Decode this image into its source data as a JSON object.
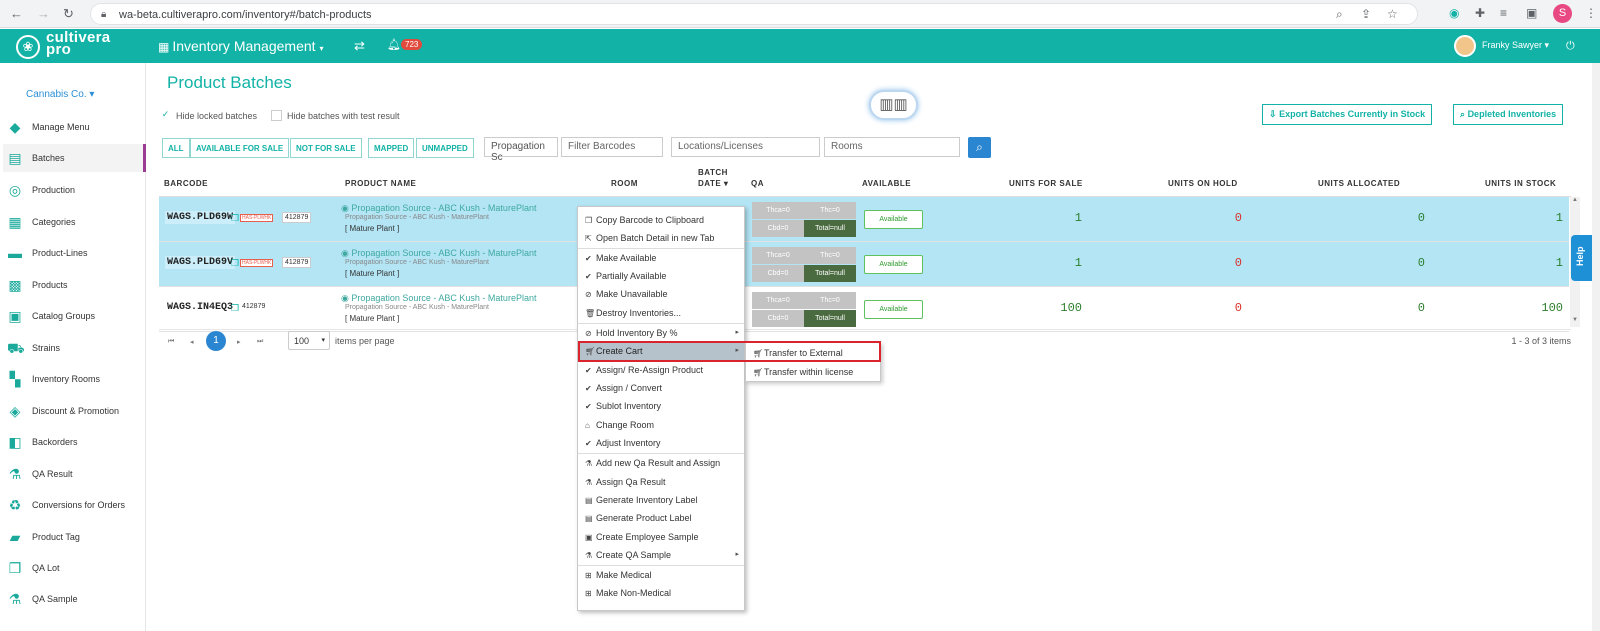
{
  "browser": {
    "url": "wa-beta.cultiverapro.com/inventory#/batch-products",
    "profile_initial": "S"
  },
  "header": {
    "logo_top": "cultivera",
    "logo_bottom": "pro",
    "module": "Inventory Management",
    "notifications": "723",
    "user": "Franky Sawyer"
  },
  "sidebar": {
    "company": "Cannabis Co.",
    "items": [
      {
        "label": "Manage Menu",
        "icon": "tag-icon"
      },
      {
        "label": "Batches",
        "icon": "clipboard-icon"
      },
      {
        "label": "Production",
        "icon": "spiral-icon"
      },
      {
        "label": "Categories",
        "icon": "table-icon"
      },
      {
        "label": "Product-Lines",
        "icon": "product-lines-icon"
      },
      {
        "label": "Products",
        "icon": "grid-icon"
      },
      {
        "label": "Catalog Groups",
        "icon": "catalog-icon"
      },
      {
        "label": "Strains",
        "icon": "truck-icon"
      },
      {
        "label": "Inventory Rooms",
        "icon": "rooms-icon"
      },
      {
        "label": "Discount & Promotion",
        "icon": "tags-icon"
      },
      {
        "label": "Backorders",
        "icon": "backorder-icon"
      },
      {
        "label": "QA Result",
        "icon": "flask-icon"
      },
      {
        "label": "Conversions for Orders",
        "icon": "recycle-icon"
      },
      {
        "label": "Product Tag",
        "icon": "label-icon"
      },
      {
        "label": "QA Lot",
        "icon": "copy-icon"
      },
      {
        "label": "QA Sample",
        "icon": "flask-icon"
      }
    ]
  },
  "page": {
    "title": "Product Batches",
    "hide_locked": "Hide locked batches",
    "hide_test": "Hide batches with test result",
    "export_btn": "Export Batches Currently in Stock",
    "depleted_btn": "Depleted Inventories"
  },
  "filters": {
    "buttons": [
      "ALL",
      "AVAILABLE FOR SALE",
      "NOT FOR SALE",
      "MAPPED",
      "UNMAPPED"
    ],
    "propagation_value": "Propagation Sc",
    "barcodes_placeholder": "Filter Barcodes",
    "locations_placeholder": "Locations/Licenses",
    "rooms_placeholder": "Rooms"
  },
  "table": {
    "headers": {
      "barcode": "BARCODE",
      "product": "PRODUCT NAME",
      "room": "ROOM",
      "batch_date_1": "BATCH",
      "batch_date_2": "DATE ▾",
      "qa": "QA",
      "available": "AVAILABLE",
      "units_for_sale": "UNITS FOR SALE",
      "units_on_hold": "UNITS ON HOLD",
      "units_allocated": "UNITS ALLOCATED",
      "units_in_stock": "UNITS IN STOCK"
    },
    "rows": [
      {
        "barcode": "WAGS.PLD69W",
        "tag": "HAS-PLWHK",
        "license": "412879",
        "product_main": "Propagation Source - ABC Kush - MaturePlant",
        "product_sub": "Propagation Source - ABC Kush - MaturePlant",
        "product_type": "[ Mature Plant ]",
        "thca": "Thca=0",
        "thc": "Thc=0",
        "cbd": "Cbd=0",
        "total": "Total=null",
        "available": "Available",
        "for_sale": "1",
        "on_hold": "0",
        "allocated": "0",
        "in_stock": "1"
      },
      {
        "barcode": "WAGS.PLD69V",
        "tag": "HAS-PLWHK",
        "license": "412879",
        "product_main": "Propagation Source - ABC Kush - MaturePlant",
        "product_sub": "Propagation Source - ABC Kush - MaturePlant",
        "product_type": "[ Mature Plant ]",
        "thca": "Thca=0",
        "thc": "Thc=0",
        "cbd": "Cbd=0",
        "total": "Total=null",
        "available": "Available",
        "for_sale": "1",
        "on_hold": "0",
        "allocated": "0",
        "in_stock": "1"
      },
      {
        "barcode": "WAGS.IN4EQ3",
        "tag": "",
        "license": "412879",
        "product_main": "Propagation Source - ABC Kush - MaturePlant",
        "product_sub": "Propagation Source - ABC Kush - MaturePlant",
        "product_type": "[ Mature Plant ]",
        "thca": "Thca=0",
        "thc": "Thc=0",
        "cbd": "Cbd=0",
        "total": "Total=null",
        "available": "Available",
        "for_sale": "100",
        "on_hold": "0",
        "allocated": "0",
        "in_stock": "100"
      }
    ]
  },
  "pager": {
    "current": "1",
    "per_page": "100",
    "per_page_label": "items per page",
    "count": "1 - 3 of 3 items"
  },
  "help": "Help",
  "context_menu": {
    "items": [
      {
        "label": "Copy Barcode to Clipboard",
        "icon": "copy-icon"
      },
      {
        "label": "Open Batch Detail in new Tab",
        "icon": "external-link-icon"
      },
      {
        "label": "Make Available",
        "icon": "check-circle-icon"
      },
      {
        "label": "Partially Available",
        "icon": "check-circle-icon"
      },
      {
        "label": "Make Unavailable",
        "icon": "ban-icon"
      },
      {
        "label": "Destroy Inventories...",
        "icon": "trash-icon"
      },
      {
        "label": "Hold Inventory By %",
        "icon": "ban-icon"
      },
      {
        "label": "Create Cart",
        "icon": "cart-icon"
      },
      {
        "label": "Assign/ Re-Assign Product",
        "icon": "check-circle-icon"
      },
      {
        "label": "Assign / Convert",
        "icon": "check-circle-icon"
      },
      {
        "label": "Sublot Inventory",
        "icon": "check-circle-icon"
      },
      {
        "label": "Change Room",
        "icon": "home-icon"
      },
      {
        "label": "Adjust Inventory",
        "icon": "check-circle-icon"
      },
      {
        "label": "Add new Qa Result and Assign",
        "icon": "flask-icon"
      },
      {
        "label": "Assign Qa Result",
        "icon": "flask-icon"
      },
      {
        "label": "Generate Inventory Label",
        "icon": "file-icon"
      },
      {
        "label": "Generate Product Label",
        "icon": "file-icon"
      },
      {
        "label": "Create Employee Sample",
        "icon": "user-card-icon"
      },
      {
        "label": "Create QA Sample",
        "icon": "flask-icon"
      },
      {
        "label": "Make Medical",
        "icon": "plus-square-icon"
      },
      {
        "label": "Make Non-Medical",
        "icon": "plus-square-icon"
      }
    ],
    "submenu": [
      {
        "label": "Transfer to External",
        "icon": "cart-icon"
      },
      {
        "label": "Transfer within license",
        "icon": "cart-icon"
      }
    ]
  },
  "colors": {
    "brand": "#12b3a6",
    "selected_row": "#b3e5f5",
    "highlight_box": "#d9232d"
  }
}
